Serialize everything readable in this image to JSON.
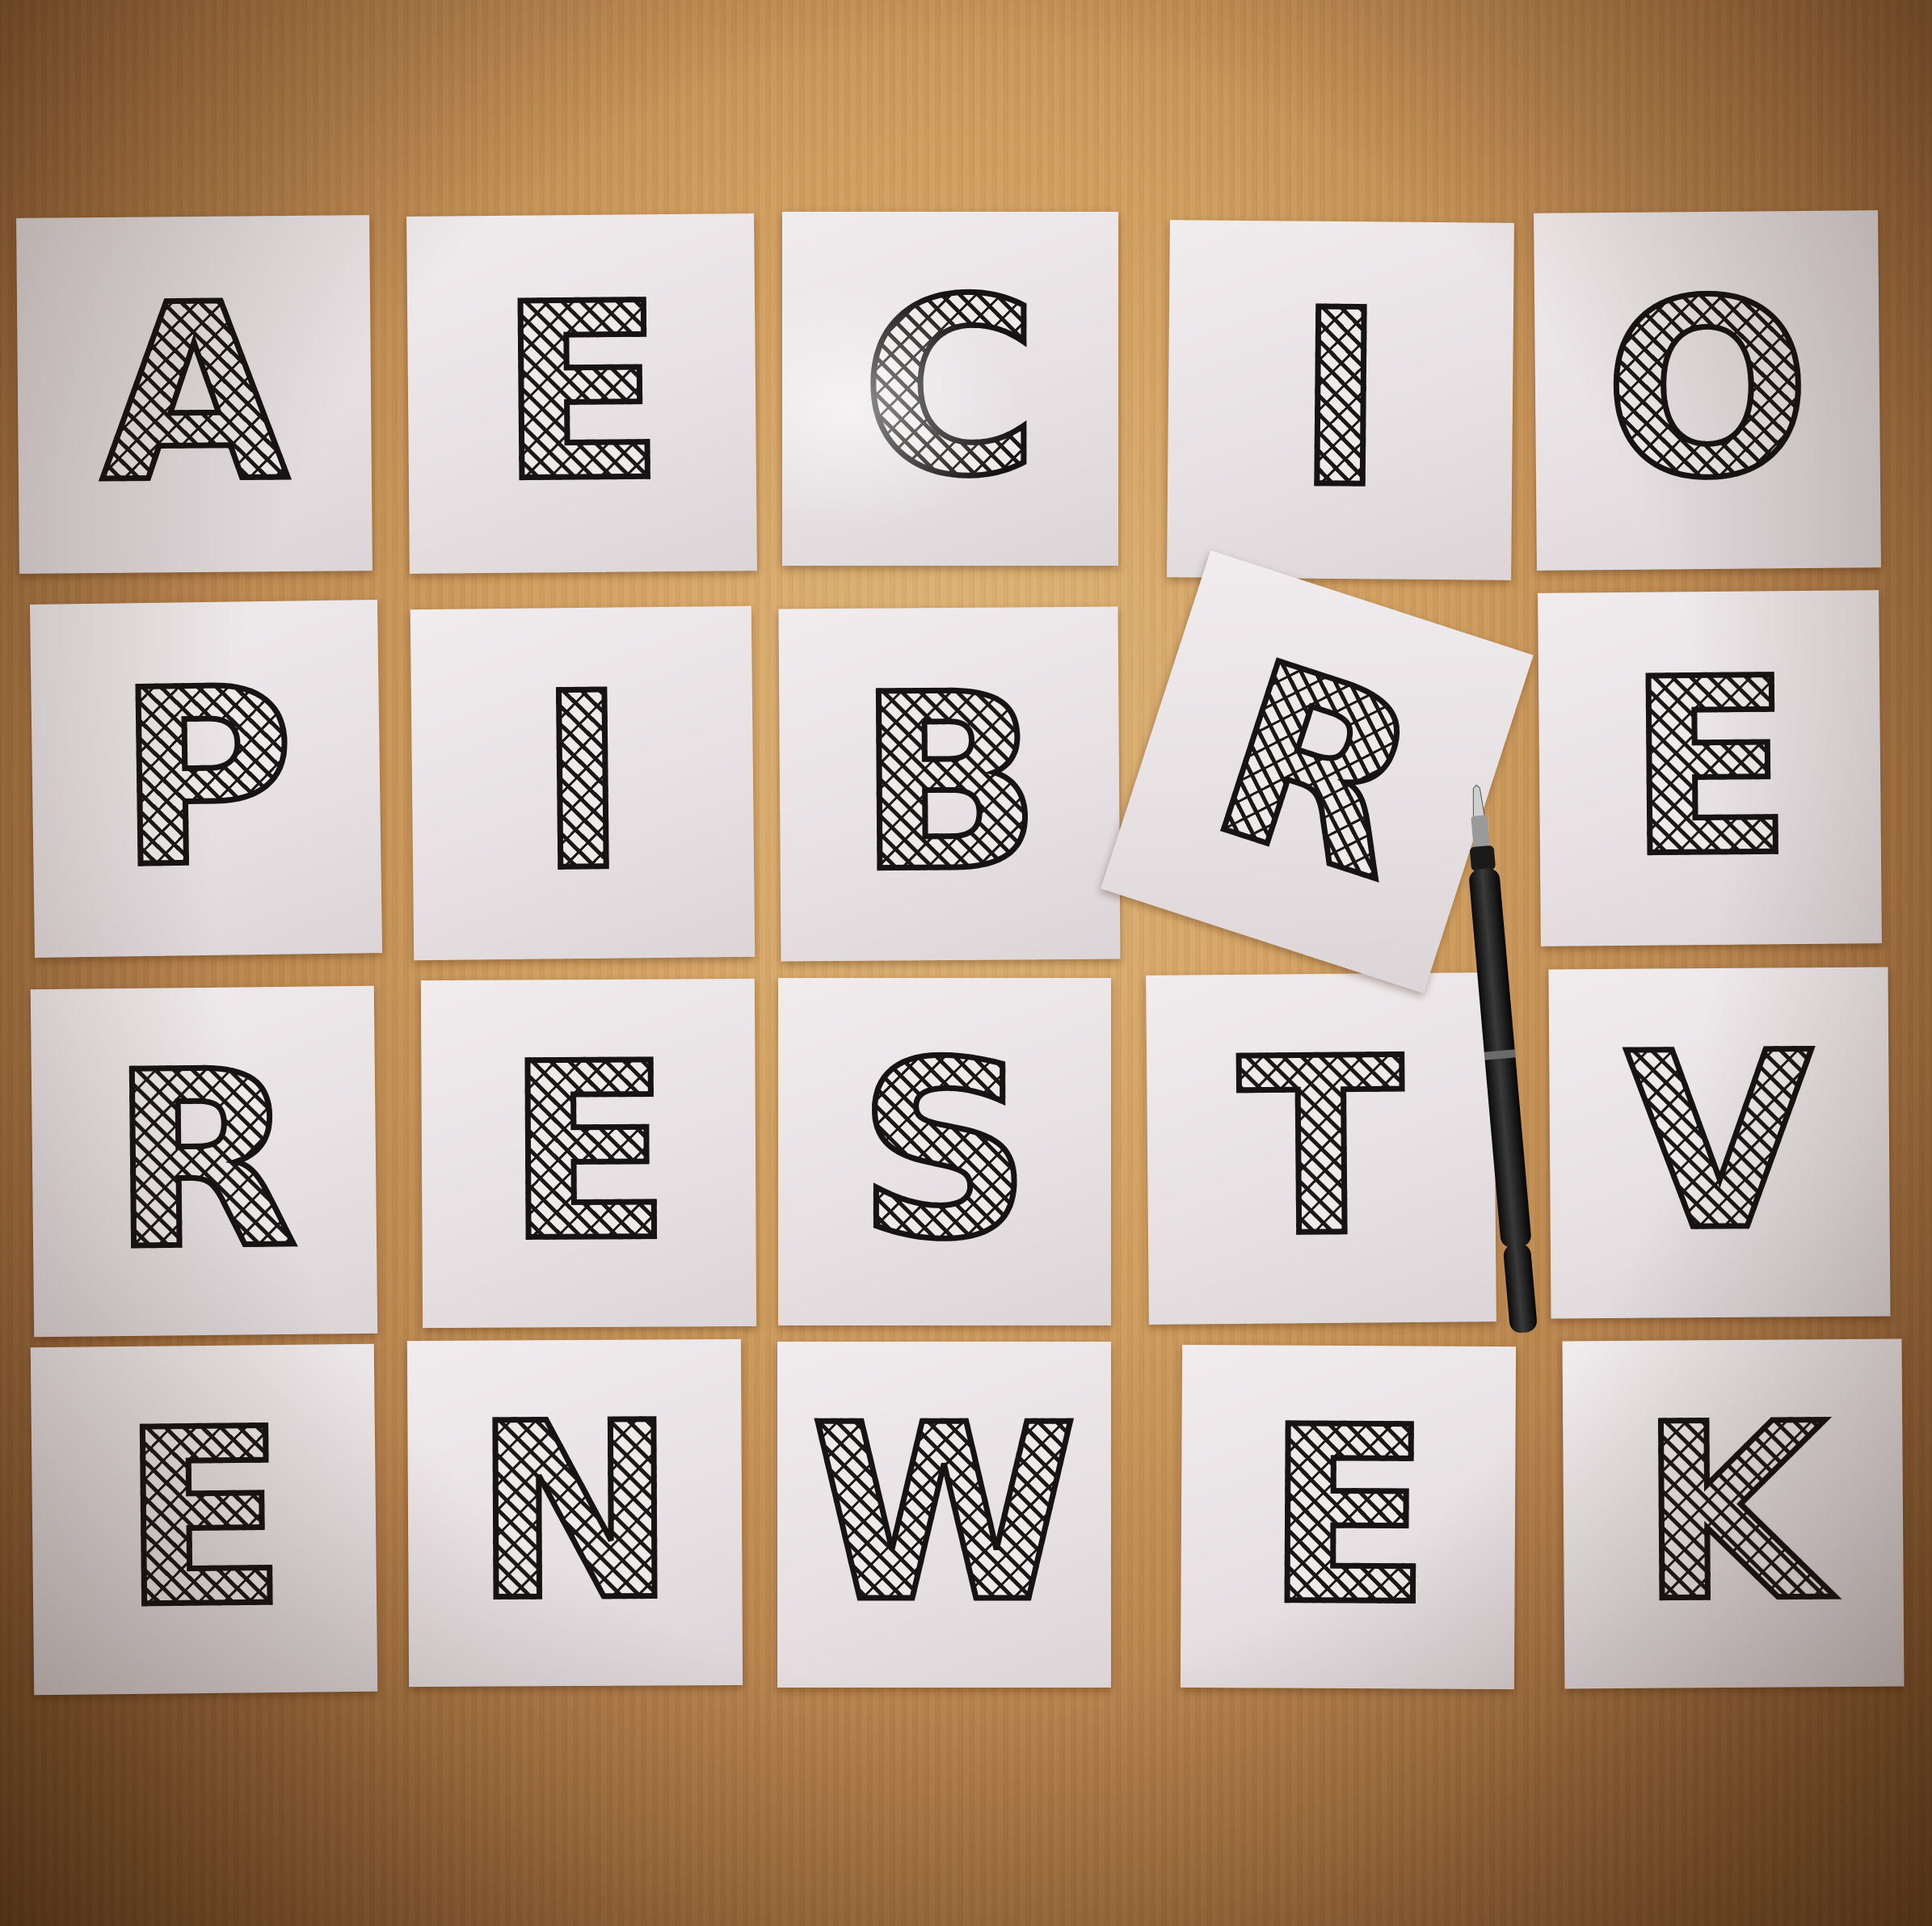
{
  "scene": "letter cards on wooden table",
  "cards": [
    {
      "letter": "A"
    },
    {
      "letter": "E"
    },
    {
      "letter": "C"
    },
    {
      "letter": "I"
    },
    {
      "letter": "O"
    },
    {
      "letter": "P"
    },
    {
      "letter": "I"
    },
    {
      "letter": "B"
    },
    {
      "letter": "R"
    },
    {
      "letter": "E"
    },
    {
      "letter": "R"
    },
    {
      "letter": "E"
    },
    {
      "letter": "S"
    },
    {
      "letter": "T"
    },
    {
      "letter": "V"
    },
    {
      "letter": "E"
    },
    {
      "letter": "N"
    },
    {
      "letter": "W"
    },
    {
      "letter": "E"
    },
    {
      "letter": "K"
    }
  ],
  "colors": {
    "table": "#cf9d5e",
    "card": "#ebe6e8",
    "ink": "#151313",
    "pen": "#121212"
  }
}
